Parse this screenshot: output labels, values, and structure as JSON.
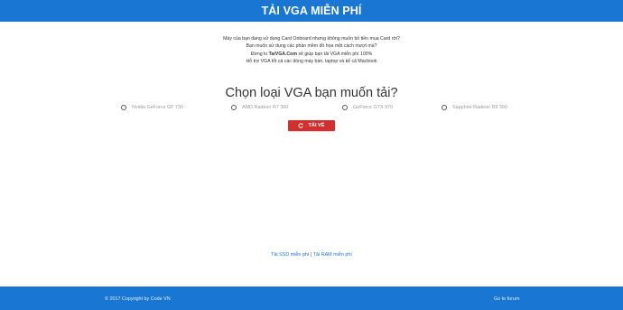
{
  "header": {
    "title": "TẢI VGA MIỄN PHÍ"
  },
  "intro": {
    "line1": "Máy của bạn đang sử dụng Card Onboard nhưng không muốn bỏ tiền mua Card rời?",
    "line2": "Bạn muốn sử dụng các phần mềm đồ họa một cách mượt mà?",
    "line3_prefix": "Đừng lo ",
    "line3_brand": "TaiVGA.Com",
    "line3_suffix": " sẽ giúp bạn tải VGA miễn phí 100%",
    "line4": "Hỗ trợ VGA tốt cả các dòng máy bàn, laptop và kể cả Macbook"
  },
  "chooser": {
    "heading": "Chọn loại VGA bạn muốn tải?",
    "options": [
      {
        "label": "Nvidia GeForce GT 730"
      },
      {
        "label": "AMD Radeon R7 360"
      },
      {
        "label": "GeForce GTX 970"
      },
      {
        "label": "Sapphire Radeon R9 390"
      }
    ],
    "button_label": "TẢI VỀ"
  },
  "links": {
    "ssd": "Tải SSD miễn phí",
    "separator": " | ",
    "ram": "Tải RAM miễn phí"
  },
  "footer": {
    "copyright": "© 2017 Copyright by Code VN",
    "forum_link": "Go to forum"
  },
  "colors": {
    "header_bg": "#1976d2",
    "button_bg": "#d32f2f",
    "link": "#1976d2"
  },
  "icons": {
    "button_icon": "refresh-icon"
  }
}
